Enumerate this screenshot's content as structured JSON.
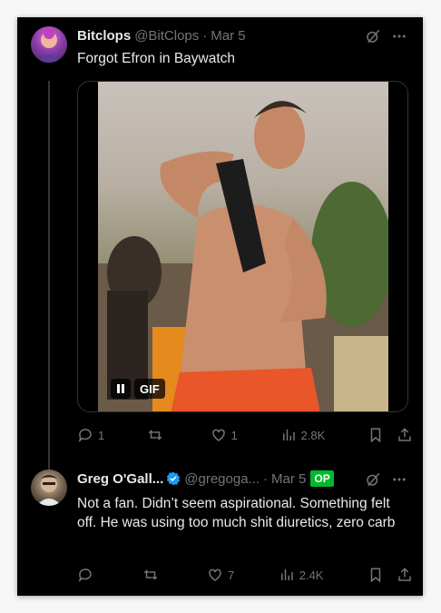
{
  "tweet1": {
    "name": "Bitclops",
    "handle": "@BitClops",
    "date": "Mar 5",
    "text": "Forgot Efron in Baywatch",
    "media": {
      "badge": "GIF"
    },
    "stats": {
      "replies": "1",
      "reposts": "",
      "likes": "1",
      "views": "2.8K"
    }
  },
  "tweet2": {
    "name": "Greg O'Gall...",
    "handle": "@gregoga...",
    "date": "Mar 5",
    "badge": "OP",
    "text": "Not a fan. Didn’t seem aspirational. Something felt off. He was using too much shit diuretics, zero carb",
    "stats": {
      "replies": "",
      "reposts": "",
      "likes": "7",
      "views": "2.4K"
    }
  },
  "colors": {
    "background": "#000000",
    "text": "#e7e9ea",
    "muted": "#71767b",
    "verified": "#1d9bf0",
    "op_badge": "#00ba2a"
  }
}
